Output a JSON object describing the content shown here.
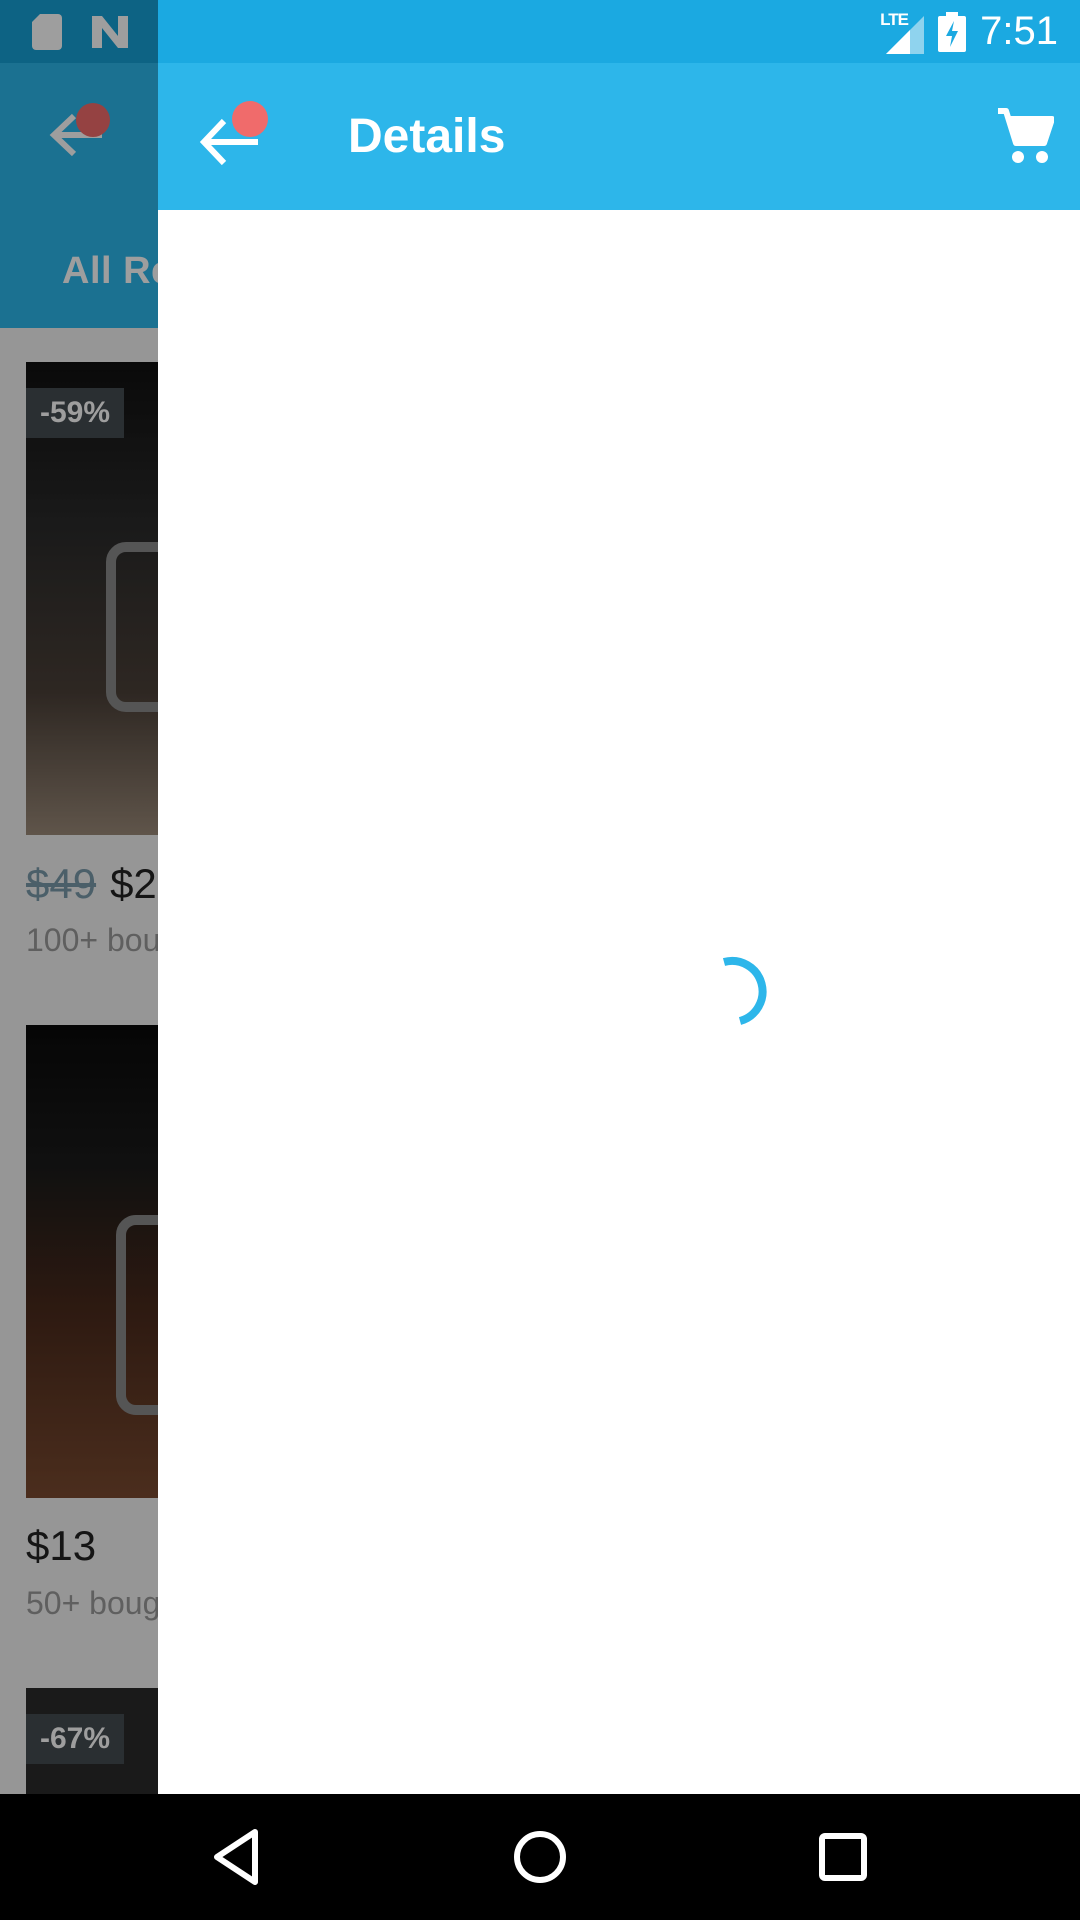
{
  "background_screen": {
    "tab_label": "All Re",
    "items": [
      {
        "discount": "-59%",
        "old_price": "$49",
        "price": "$2",
        "bought": "100+ bou"
      },
      {
        "discount": "",
        "old_price": "",
        "price": "$13",
        "bought": "50+ boug"
      },
      {
        "discount": "-67%",
        "old_price": "",
        "price": "",
        "bought": ""
      }
    ]
  },
  "status_bar": {
    "time": "7:51",
    "network": "LTE",
    "icons": [
      "sd-card-icon",
      "n-logo-icon",
      "lte-signal-icon",
      "battery-charging-icon"
    ]
  },
  "toolbar": {
    "title": "Details",
    "back_icon": "arrow-back-icon",
    "cart_icon": "shopping-cart-icon"
  },
  "content": {
    "state": "loading"
  },
  "nav_bar": {
    "icons": [
      "nav-back-icon",
      "nav-home-icon",
      "nav-recents-icon"
    ]
  },
  "colors": {
    "primary": "#2db6ea",
    "status_bar": "#1ba9e1",
    "badge": "#f06b6b",
    "spinner": "#2db6ea"
  }
}
